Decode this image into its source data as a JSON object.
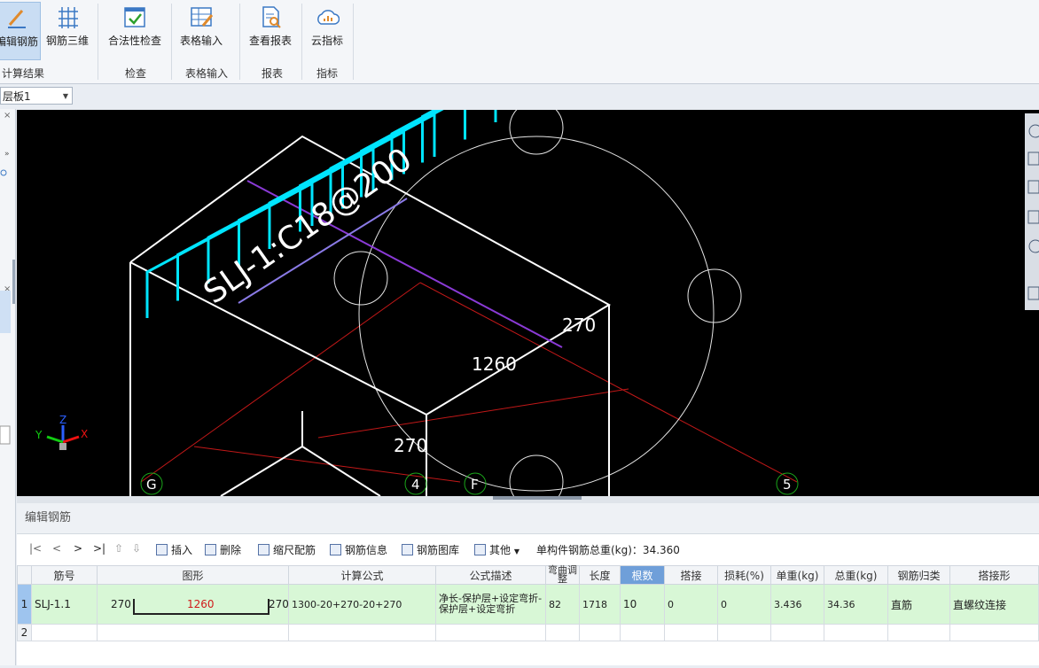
{
  "ribbon": {
    "buttons": [
      {
        "label": "编辑钢筋",
        "icon": "pencil-icon"
      },
      {
        "label": "钢筋三维",
        "icon": "rebar-3d-icon"
      },
      {
        "label": "合法性检查",
        "icon": "check-icon"
      },
      {
        "label": "表格输入",
        "icon": "table-input-icon"
      },
      {
        "label": "查看报表",
        "icon": "report-icon"
      },
      {
        "label": "云指标",
        "icon": "cloud-icon"
      }
    ],
    "groups": [
      "计算结果",
      "检查",
      "表格输入",
      "报表",
      "指标"
    ]
  },
  "floor_select": {
    "value": "层板1"
  },
  "canvas": {
    "label_main": "SLJ-1:C18@200",
    "dim_top": "270",
    "dim_mid": "1260",
    "dim_bottom": "270",
    "axes": [
      "G",
      "4",
      "F",
      "5"
    ],
    "triad": {
      "x": "X",
      "y": "Y",
      "z": "Z"
    }
  },
  "panel": {
    "title": "编辑钢筋",
    "nav": [
      "|<",
      "<",
      ">",
      ">|"
    ],
    "toolbar": [
      {
        "label": "插入",
        "icon": "insert-icon"
      },
      {
        "label": "删除",
        "icon": "delete-icon"
      },
      {
        "label": "缩尺配筋",
        "icon": "scale-icon"
      },
      {
        "label": "钢筋信息",
        "icon": "info-icon"
      },
      {
        "label": "钢筋图库",
        "icon": "library-icon"
      },
      {
        "label": "其他",
        "icon": "other-icon"
      }
    ],
    "total_weight": "单构件钢筋总重(kg)：34.360",
    "columns": [
      "筋号",
      "图形",
      "计算公式",
      "公式描述",
      "弯曲调整",
      "长度",
      "根数",
      "搭接",
      "损耗(%)",
      "单重(kg)",
      "总重(kg)",
      "钢筋归类",
      "搭接形"
    ],
    "rows": [
      {
        "num": "1",
        "name": "SLJ-1.1",
        "shape_left": "270",
        "shape_mid": "1260",
        "shape_right": "270",
        "formula": "1300-20+270-20+270",
        "desc": "净长-保护层+设定弯折-保护层+设定弯折",
        "bend": "82",
        "length": "1718",
        "count": "10",
        "lap": "0",
        "loss": "0",
        "unit_wt": "3.436",
        "total_wt": "34.36",
        "category": "直筋",
        "lap_type": "直螺纹连接"
      },
      {
        "num": "2",
        "name": "",
        "shape_left": "",
        "shape_mid": "",
        "shape_right": "",
        "formula": "",
        "desc": "",
        "bend": "",
        "length": "",
        "count": "",
        "lap": "",
        "loss": "",
        "unit_wt": "",
        "total_wt": "",
        "category": "",
        "lap_type": ""
      }
    ]
  },
  "colors": {
    "accent": "#6f9fd9",
    "rebar": "#00e5ff",
    "row_selected": "#d8f7d6",
    "axis_line": "#d11a1a"
  }
}
